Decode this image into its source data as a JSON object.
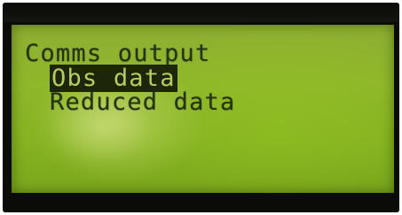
{
  "display": {
    "title": "Comms output",
    "menu": {
      "items": [
        {
          "label": "Obs data",
          "selected": true
        },
        {
          "label": "Reduced data",
          "selected": false
        }
      ]
    }
  },
  "colors": {
    "lcd_background": "#8fb72a",
    "text": "#263311",
    "selection_background": "#1d2609",
    "selection_text": "#b7cf5a",
    "bezel": "#0b0c08"
  }
}
